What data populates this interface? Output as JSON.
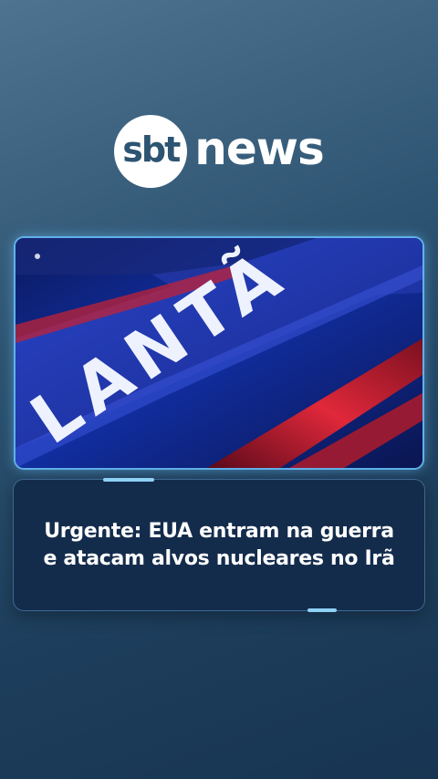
{
  "brand": {
    "circle_text": "sbt",
    "word": "news"
  },
  "media": {
    "sign_text": "LANTÃ"
  },
  "headline": {
    "line1": "Urgente: EUA entram na guerra",
    "line2": "e atacam alvos nucleares no Irã"
  },
  "colors": {
    "background_top": "#4e7390",
    "background_bottom": "#173552",
    "card": "#142c4c",
    "accent": "#8fd0f5",
    "frame_glow": "#5fb1e8"
  }
}
